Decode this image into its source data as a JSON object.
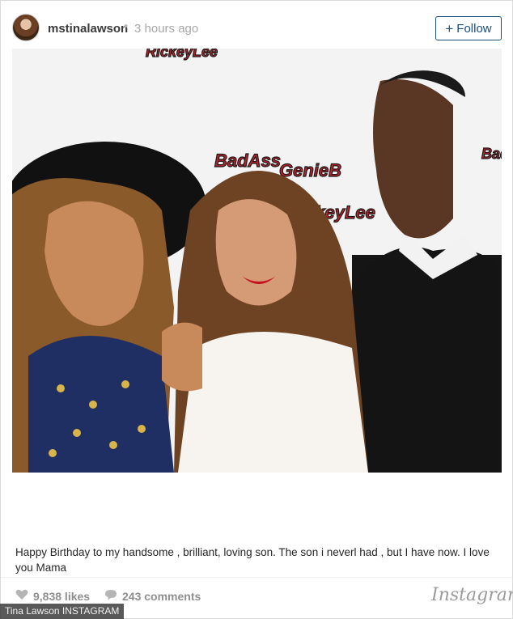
{
  "post": {
    "username": "mstinalawson",
    "separator": "•",
    "time_ago": "3 hours ago",
    "follow_label": "Follow",
    "follow_icon": "plus-icon",
    "photo_backdrop_text": [
      "BadAss",
      "GenieB",
      "RickeyLee"
    ],
    "caption": "Happy Birthday to my handsome , brilliant, loving son. The son i neverl had , but I have now. I love you Mama",
    "likes": "9,838 likes",
    "likes_icon": "heart-icon",
    "comments": "243 comments",
    "comments_icon": "speech-bubble-icon",
    "brand": "Instagram"
  },
  "credit": "Tina Lawson INSTAGRAM",
  "colors": {
    "follow_blue": "#1a4f7a",
    "meta_gray": "#8e8e8e",
    "backdrop_red": "#c0202a"
  }
}
